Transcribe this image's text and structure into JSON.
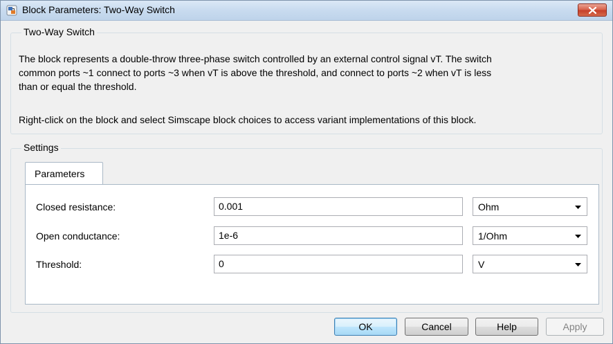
{
  "window": {
    "title": "Block Parameters: Two-Way Switch"
  },
  "description_group": {
    "legend": "Two-Way Switch",
    "paragraph1_line1": "The block represents a double-throw three-phase switch controlled by an external control signal vT. The switch",
    "paragraph1_line2": "common ports ~1 connect to ports ~3 when vT is above the threshold, and connect to ports ~2 when vT is less",
    "paragraph1_line3": "than or equal the threshold.",
    "paragraph2": "Right-click on the block and select Simscape block choices to access variant implementations of this block."
  },
  "settings": {
    "legend": "Settings",
    "tab_label": "Parameters",
    "params": [
      {
        "label": "Closed resistance:",
        "value": "0.001",
        "unit": "Ohm"
      },
      {
        "label": "Open conductance:",
        "value": "1e-6",
        "unit": "1/Ohm"
      },
      {
        "label": "Threshold:",
        "value": "0",
        "unit": "V"
      }
    ]
  },
  "buttons": {
    "ok": "OK",
    "cancel": "Cancel",
    "help": "Help",
    "apply": "Apply"
  },
  "colors": {
    "close_button": "#c5402a",
    "default_button_border": "#3c7fb1"
  },
  "icons": {
    "app": "simulink-block-icon",
    "close": "close-icon",
    "dropdown": "chevron-down-icon"
  }
}
